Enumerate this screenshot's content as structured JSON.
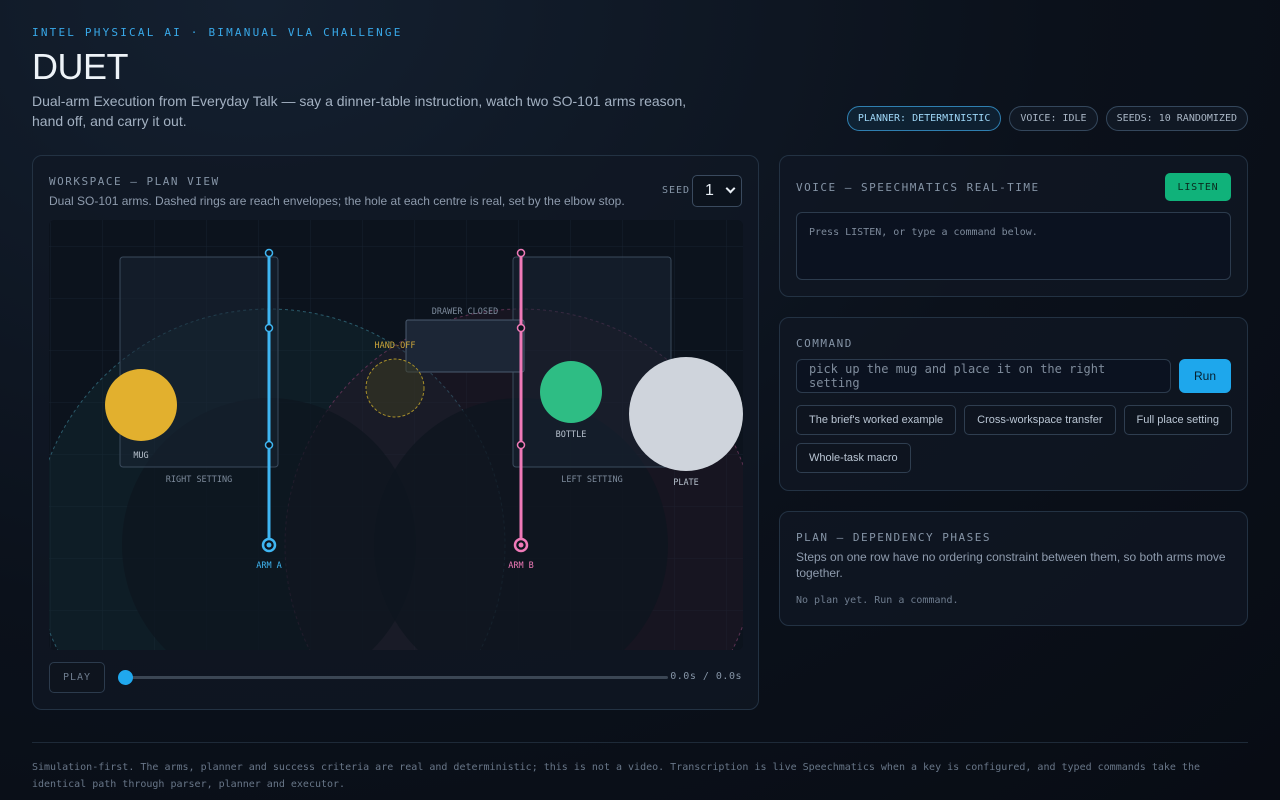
{
  "header": {
    "eyebrow": "INTEL PHYSICAL AI · BIMANUAL VLA CHALLENGE",
    "title": "DUET",
    "subtitle": "Dual-arm Execution from Everyday Talk — say a dinner-table instruction, watch two SO-101 arms reason, hand off, and carry it out.",
    "pills": [
      "PLANNER: DETERMINISTIC",
      "VOICE: IDLE",
      "SEEDS: 10 RANDOMIZED"
    ]
  },
  "workspace": {
    "label": "WORKSPACE — PLAN VIEW",
    "description": "Dual SO-101 arms. Dashed rings are reach envelopes; the hole at each centre is real, set by the elbow stop.",
    "seed_label": "SEED",
    "seed_value": "1",
    "labels": {
      "drawer": "DRAWER CLOSED",
      "handoff": "HAND-OFF",
      "mug": "MUG",
      "bottle": "BOTTLE",
      "plate": "PLATE",
      "right_setting": "RIGHT SETTING",
      "left_setting": "LEFT SETTING",
      "arm_a": "ARM A",
      "arm_b": "ARM B"
    },
    "colors": {
      "arm_a": "#3fb6f2",
      "arm_b": "#f07ab8",
      "mug": "#e2b02e",
      "bottle": "#2ebd84",
      "plate": "#cfd4dc"
    },
    "play_label": "PLAY",
    "progress": 0,
    "time": "0.0s / 0.0s"
  },
  "voice": {
    "label": "VOICE — SPEECHMATICS REAL-TIME",
    "listen_label": "LISTEN",
    "transcript_placeholder": "Press LISTEN, or type a command below."
  },
  "command": {
    "label": "COMMAND",
    "input_placeholder": "pick up the mug and place it on the right setting",
    "run_label": "Run",
    "examples": [
      "The brief's worked example",
      "Cross-workspace transfer",
      "Full place setting",
      "Whole-task macro"
    ]
  },
  "plan": {
    "label": "PLAN — DEPENDENCY PHASES",
    "description": "Steps on one row have no ordering constraint between them, so both arms move together.",
    "empty": "No plan yet. Run a command."
  },
  "footer": "Simulation-first. The arms, planner and success criteria are real and deterministic; this is not a video. Transcription is live Speechmatics when a key is configured, and typed commands take the identical path through parser, planner and executor."
}
